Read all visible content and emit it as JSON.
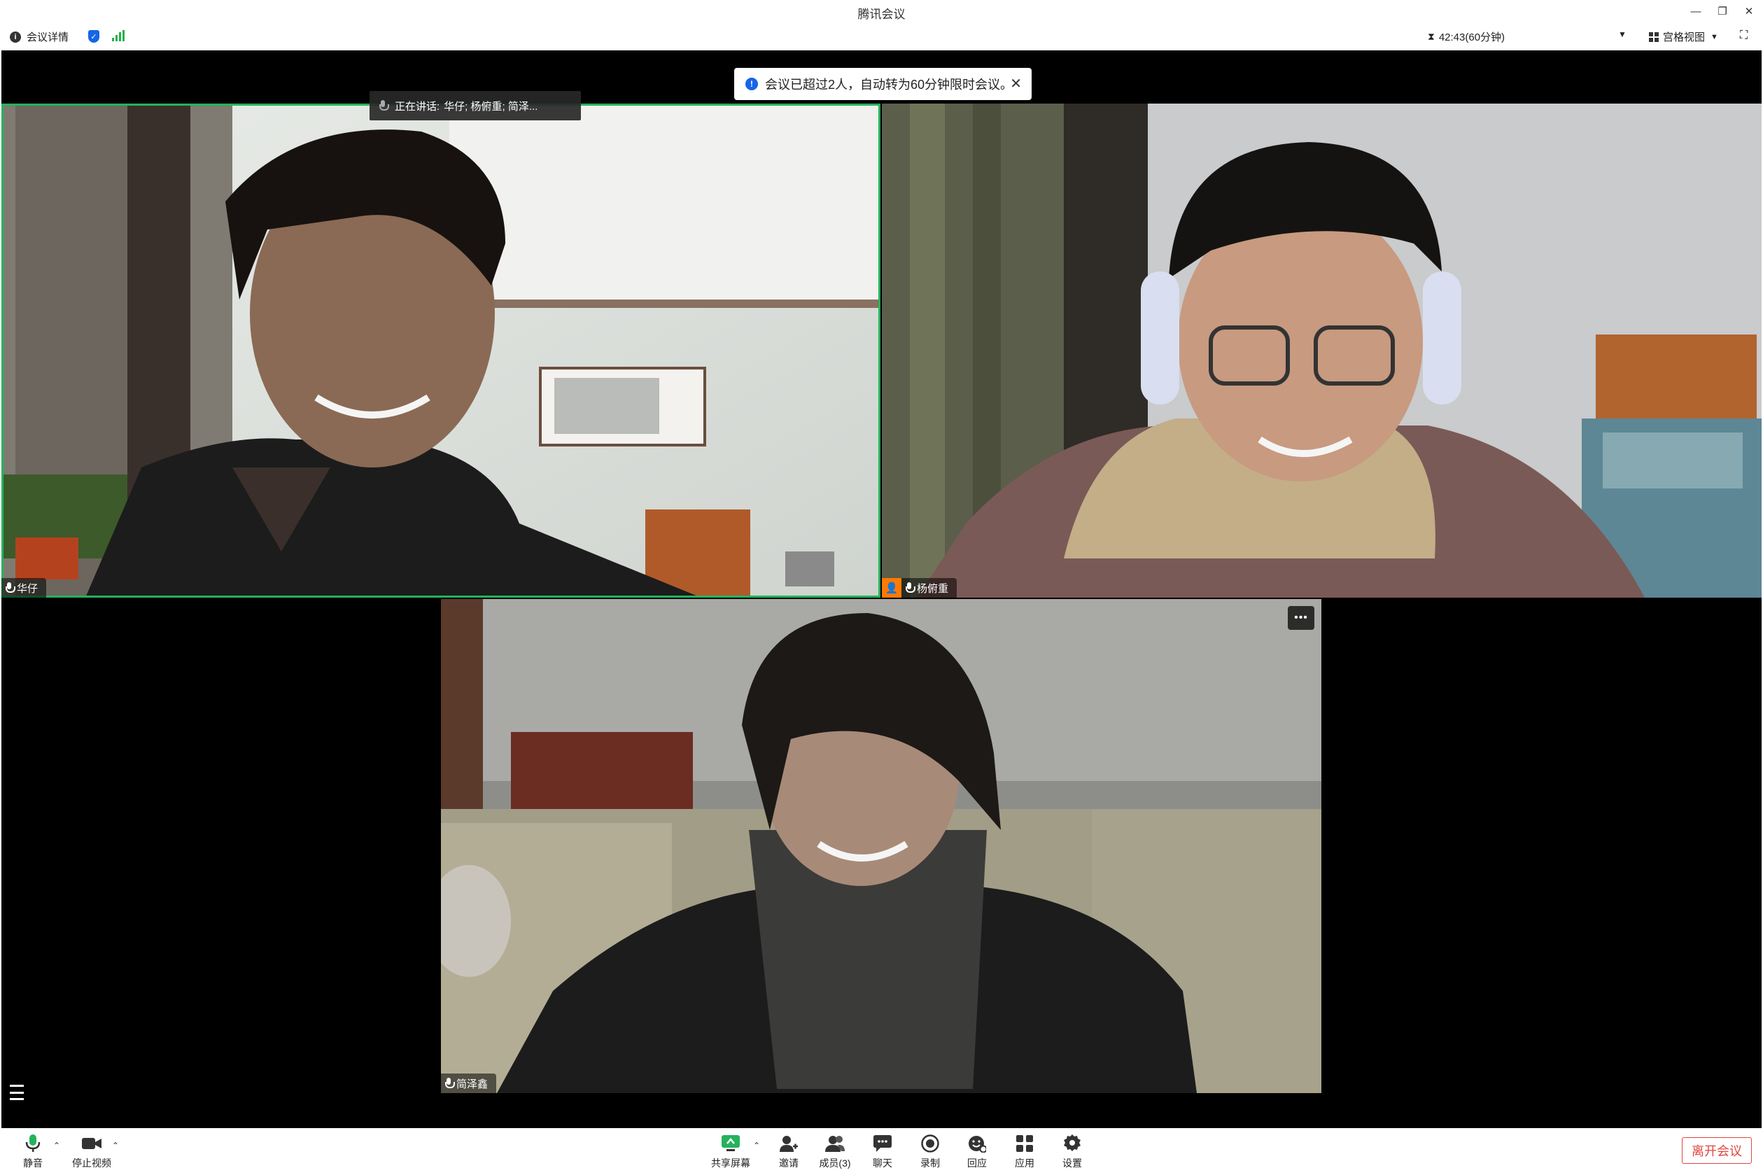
{
  "window": {
    "title": "腾讯会议",
    "minimize": "—",
    "restore": "❐",
    "close": "✕"
  },
  "infobar": {
    "details_label": "会议详情",
    "timer": "42:43(60分钟)",
    "view_label": "宫格视图"
  },
  "notice": {
    "text": "会议已超过2人，自动转为60分钟限时会议。"
  },
  "speaking": {
    "label": "正在讲话:",
    "names": "华仔; 杨俯重; 简泽..."
  },
  "participants": [
    {
      "name": "华仔",
      "speaking": true
    },
    {
      "name": "杨俯重",
      "host": true
    },
    {
      "name": "简泽鑫"
    }
  ],
  "toolbar": {
    "mute": "静音",
    "stop_video": "停止视频",
    "share": "共享屏幕",
    "invite": "邀请",
    "members": "成员(3)",
    "chat": "聊天",
    "record": "录制",
    "reaction": "回应",
    "apps": "应用",
    "settings": "设置",
    "leave": "离开会议"
  },
  "colors": {
    "active_border": "#24b35b",
    "leave": "#e0463e",
    "accent": "#1565e6",
    "host_badge": "#ff7a00"
  }
}
